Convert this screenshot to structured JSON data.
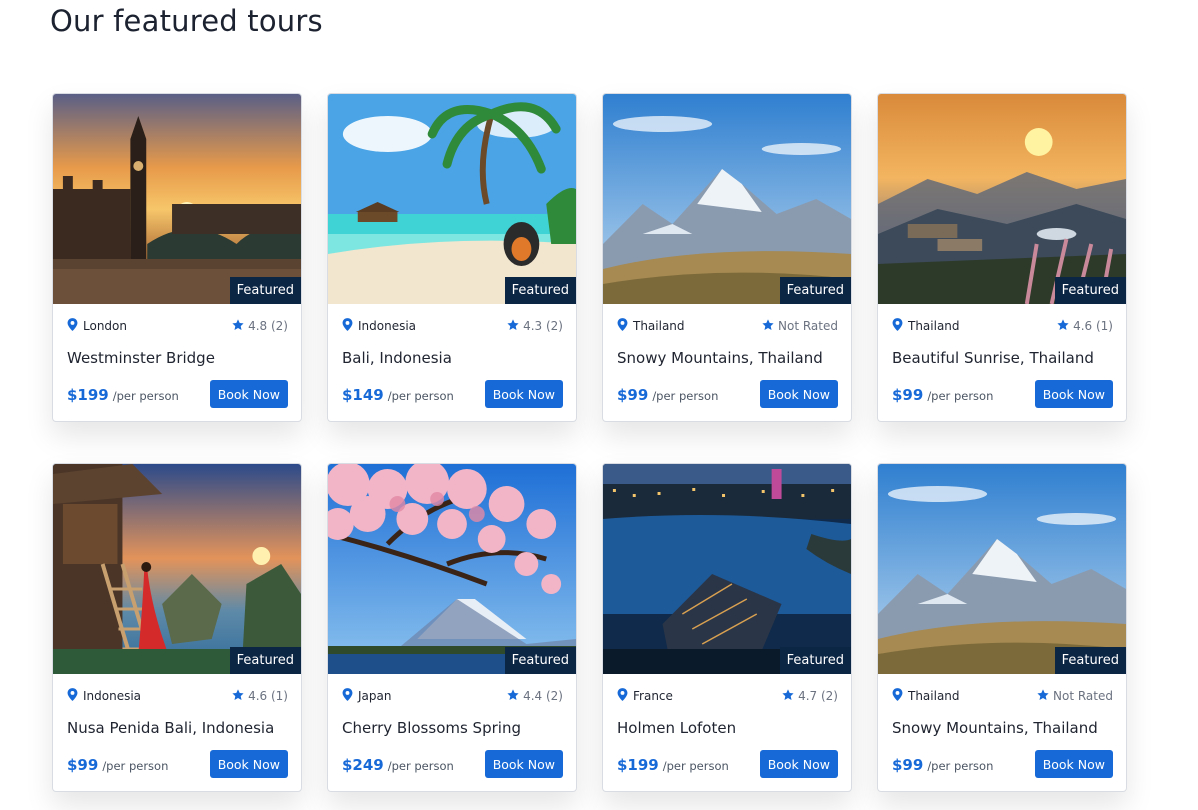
{
  "section": {
    "title": "Our featured tours"
  },
  "tours": [
    {
      "location": "London",
      "rating": "4.8 (2)",
      "name": "Westminster Bridge",
      "price": "$199",
      "per": "/per person",
      "badge": "Featured",
      "button": "Book Now",
      "image": "london-sunset"
    },
    {
      "location": "Indonesia",
      "rating": "4.3 (2)",
      "name": "Bali, Indonesia",
      "price": "$149",
      "per": "/per person",
      "badge": "Featured",
      "button": "Book Now",
      "image": "tropical-beach"
    },
    {
      "location": "Thailand",
      "rating": "Not Rated",
      "name": "Snowy Mountains, Thailand",
      "price": "$99",
      "per": "/per person",
      "badge": "Featured",
      "button": "Book Now",
      "image": "snowy-mountains"
    },
    {
      "location": "Thailand",
      "rating": "4.6 (1)",
      "name": "Beautiful Sunrise, Thailand",
      "price": "$99",
      "per": "/per person",
      "badge": "Featured",
      "button": "Book Now",
      "image": "sunrise-hills"
    },
    {
      "location": "Indonesia",
      "rating": "4.6 (1)",
      "name": "Nusa Penida Bali, Indonesia",
      "price": "$99",
      "per": "/per person",
      "badge": "Featured",
      "button": "Book Now",
      "image": "treehouse-cliff"
    },
    {
      "location": "Japan",
      "rating": "4.4 (2)",
      "name": "Cherry Blossoms Spring",
      "price": "$249",
      "per": "/per person",
      "badge": "Featured",
      "button": "Book Now",
      "image": "cherry-blossom-fuji"
    },
    {
      "location": "France",
      "rating": "4.7 (2)",
      "name": "Holmen Lofoten",
      "price": "$199",
      "per": "/per person",
      "badge": "Featured",
      "button": "Book Now",
      "image": "night-city-water"
    },
    {
      "location": "Thailand",
      "rating": "Not Rated",
      "name": "Snowy Mountains, Thailand",
      "price": "$99",
      "per": "/per person",
      "badge": "Featured",
      "button": "Book Now",
      "image": "snowy-mountains"
    }
  ],
  "colors": {
    "accent": "#1669d6",
    "badge_bg": "#0b2545",
    "price": "#1769d8"
  }
}
